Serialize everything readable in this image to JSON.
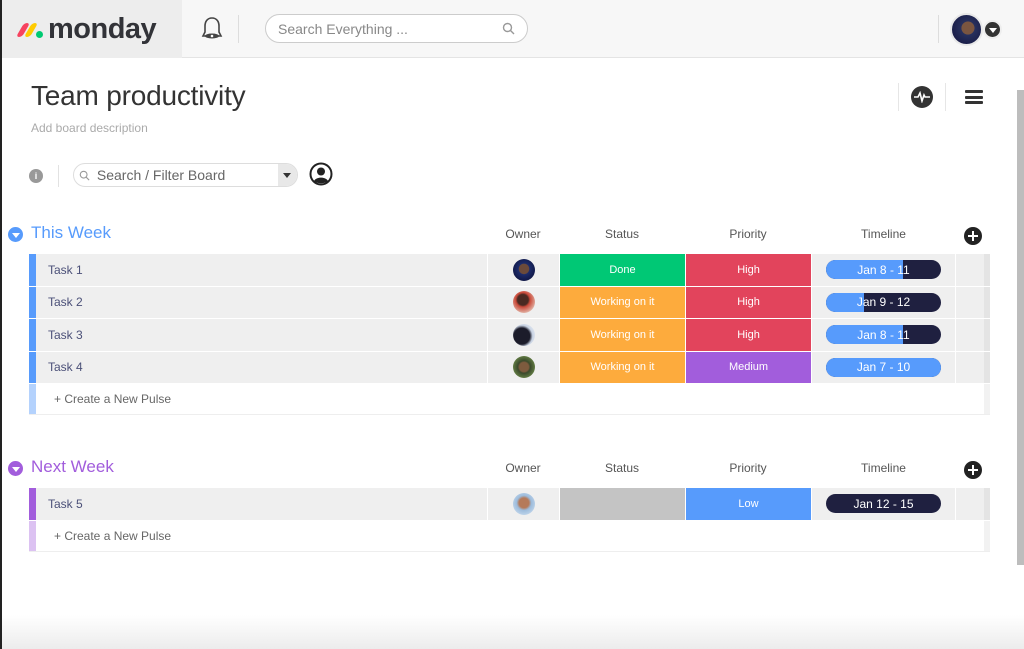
{
  "app": {
    "brand": "monday",
    "global_search_placeholder": "Search Everything ..."
  },
  "board": {
    "title": "Team productivity",
    "description_placeholder": "Add board description",
    "filter_placeholder": "Search / Filter Board",
    "info_label": "i"
  },
  "colors": {
    "this_week": "#579bfc",
    "next_week": "#a25ddc",
    "done": "#00c875",
    "working": "#fdab3d",
    "high": "#e2445c",
    "medium": "#a25ddc",
    "low": "#579bfc",
    "empty_status": "#c4c4c4",
    "timeline_fill": "#579bfc",
    "timeline_bg": "#1f2040"
  },
  "groups": [
    {
      "title": "This Week",
      "color": "#579bfc",
      "new_row_color": "#b4d2fd",
      "columns": {
        "owner": "Owner",
        "status": "Status",
        "priority": "Priority",
        "timeline": "Timeline"
      },
      "rows": [
        {
          "name": "Task 1",
          "owner_avatar": "person-1",
          "status": "Done",
          "status_color": "#00c875",
          "priority": "High",
          "priority_color": "#e2445c",
          "timeline": "Jan 8 - 11",
          "timeline_progress": 0.67
        },
        {
          "name": "Task 2",
          "owner_avatar": "person-2",
          "status": "Working on it",
          "status_color": "#fdab3d",
          "priority": "High",
          "priority_color": "#e2445c",
          "timeline": "Jan 9 - 12",
          "timeline_progress": 0.33
        },
        {
          "name": "Task 3",
          "owner_avatar": "person-3",
          "status": "Working on it",
          "status_color": "#fdab3d",
          "priority": "High",
          "priority_color": "#e2445c",
          "timeline": "Jan 8 - 11",
          "timeline_progress": 0.67
        },
        {
          "name": "Task 4",
          "owner_avatar": "person-4",
          "status": "Working on it",
          "status_color": "#fdab3d",
          "priority": "Medium",
          "priority_color": "#a25ddc",
          "timeline": "Jan 7 - 10",
          "timeline_progress": 1.0
        }
      ],
      "new_row_label": "+ Create a New Pulse"
    },
    {
      "title": "Next Week",
      "color": "#a25ddc",
      "new_row_color": "#dcc2f2",
      "columns": {
        "owner": "Owner",
        "status": "Status",
        "priority": "Priority",
        "timeline": "Timeline"
      },
      "rows": [
        {
          "name": "Task 5",
          "owner_avatar": "person-5",
          "status": "",
          "status_color": "#c4c4c4",
          "priority": "Low",
          "priority_color": "#579bfc",
          "timeline": "Jan 12 - 15",
          "timeline_progress": 0.0
        }
      ],
      "new_row_label": "+ Create a New Pulse"
    }
  ]
}
